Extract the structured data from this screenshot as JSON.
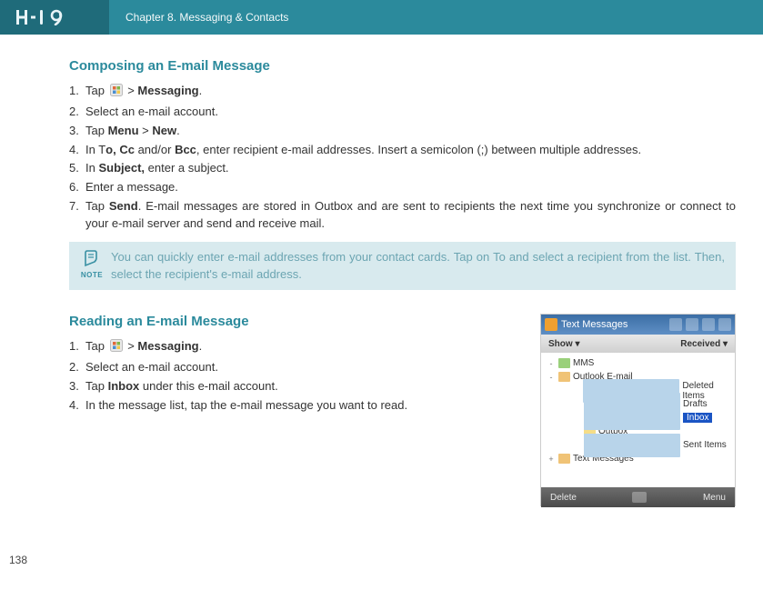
{
  "header": {
    "logo_text": "H-19",
    "chapter": "Chapter 8. Messaging & Contacts"
  },
  "page_number": "138",
  "section1": {
    "title": "Composing an E-mail Message",
    "steps": [
      {
        "n": "1.",
        "pre": "Tap ",
        "icon": true,
        "mid": " > ",
        "b1": "Messaging",
        "post": "."
      },
      {
        "n": "2.",
        "text": "Select an e-mail account."
      },
      {
        "n": "3.",
        "pre": "Tap ",
        "b1": "Menu",
        "mid": " > ",
        "b2": "New",
        "post": "."
      },
      {
        "n": "4.",
        "pre": "In T",
        "b1": "o, Cc",
        "mid": " and/or ",
        "b2": "Bcc",
        "post": ", enter recipient e-mail addresses. Insert a semicolon (;) between multiple addresses."
      },
      {
        "n": "5.",
        "pre": "In ",
        "b1": "Subject,",
        "post": " enter a subject."
      },
      {
        "n": "6.",
        "text": "Enter a message."
      },
      {
        "n": "7.",
        "pre": "Tap ",
        "b1": "Send",
        "post": ". E-mail messages are stored in Outbox and are sent to recipients the next time you synchronize or connect to your e-mail server and send and receive mail."
      }
    ]
  },
  "note": {
    "label": "NOTE",
    "text": "You can quickly enter e-mail addresses from your contact cards. Tap on To and select a recipient from the list. Then, select the recipient's e-mail address."
  },
  "section2": {
    "title": "Reading an E-mail Message",
    "steps": [
      {
        "n": "1.",
        "pre": "Tap ",
        "icon": true,
        "mid": " > ",
        "b1": "Messaging",
        "post": "."
      },
      {
        "n": "2.",
        "text": "Select an e-mail account."
      },
      {
        "n": "3.",
        "pre": "Tap ",
        "b1": "Inbox",
        "post": " under this e-mail account."
      },
      {
        "n": "4.",
        "text": "In the message list, tap the e-mail message you want to read."
      }
    ]
  },
  "pda": {
    "title": "Text Messages",
    "bar_left": "Show",
    "bar_right": "Received",
    "bottom_left": "Delete",
    "bottom_right": "Menu",
    "tree": [
      {
        "tw": "-",
        "ind": 0,
        "ic": "phone",
        "label": "MMS"
      },
      {
        "tw": "-",
        "ind": 0,
        "ic": "env",
        "label": "Outlook E-mail"
      },
      {
        "tw": "",
        "ind": 2,
        "ic": "page",
        "label": "Deleted Items"
      },
      {
        "tw": "",
        "ind": 2,
        "ic": "page",
        "label": "Drafts"
      },
      {
        "tw": "",
        "ind": 2,
        "ic": "page",
        "label": "Inbox",
        "sel": true
      },
      {
        "tw": "",
        "ind": 2,
        "ic": "folder",
        "label": "Outbox"
      },
      {
        "tw": "",
        "ind": 2,
        "ic": "page",
        "label": "Sent Items"
      },
      {
        "tw": "+",
        "ind": 0,
        "ic": "env",
        "label": "Text Messages"
      }
    ]
  }
}
